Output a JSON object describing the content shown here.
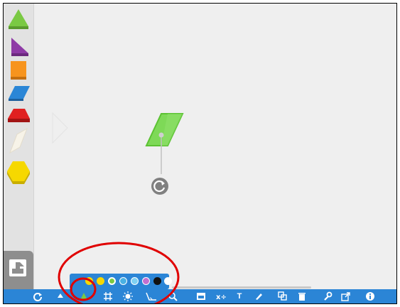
{
  "sidebar": {
    "shapes": [
      {
        "name": "triangle",
        "color": "#7ac943"
      },
      {
        "name": "right-triangle",
        "color": "#8e3aa6"
      },
      {
        "name": "square",
        "color": "#f7941d"
      },
      {
        "name": "parallelogram",
        "color": "#2b86d6"
      },
      {
        "name": "trapezoid",
        "color": "#e02020"
      },
      {
        "name": "thin-rhombus",
        "color": "#f7f3e8"
      },
      {
        "name": "hexagon",
        "color": "#f6d800"
      }
    ],
    "tool_icon": "stamp-icon"
  },
  "canvas": {
    "selected_shape": {
      "name": "rhombus",
      "color": "#7ed957",
      "outline": "#5cc233"
    },
    "rotate_icon": "rotate-icon"
  },
  "palette": {
    "swatches": [
      "#f6d800",
      "#f6d800",
      "#7ac943",
      "#4ab1e3",
      "#7fd0f2",
      "#c36fd0",
      "#111111",
      "#ffffff"
    ]
  },
  "toolbar": {
    "icons": [
      "refresh-icon",
      "fill-icon",
      "color-icon",
      "grid-icon",
      "sun-icon",
      "angle-icon",
      "zoom-icon",
      "card-icon",
      "ratio-icon",
      "text-icon",
      "pen-icon",
      "duplicate-icon",
      "trash-icon",
      "wrench-icon",
      "share-icon",
      "info-icon"
    ],
    "text_label": "T"
  },
  "colors": {
    "toolbar_bg": "#2b85d6",
    "annotation": "#e00000"
  }
}
